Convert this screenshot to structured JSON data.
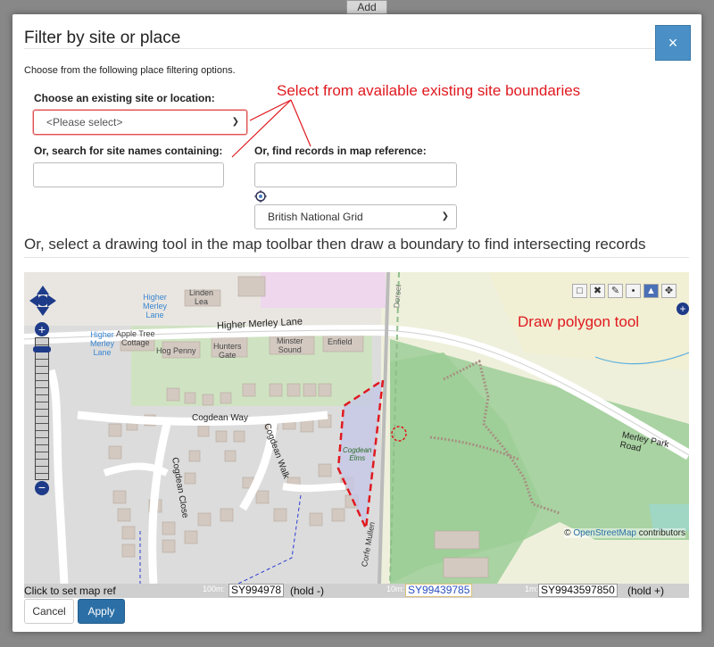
{
  "background": {
    "add_label": "Add"
  },
  "dialog": {
    "title": "Filter by site or place",
    "close_glyph": "×",
    "intro": "Choose from the following place filtering options.",
    "existing_site_label": "Choose an existing site or location:",
    "existing_site_value": "<Please select>",
    "search_label": "Or, search for site names containing:",
    "mapref_label": "Or, find records in map reference:",
    "grid_system_value": "British National Grid",
    "drawing_heading": "Or, select a drawing tool in the map toolbar then draw a boundary to find intersecting records",
    "annotation_select": "Select from available existing site boundaries",
    "annotation_draw": "Draw polygon tool"
  },
  "map": {
    "attribution_prefix": "© ",
    "attribution_link": "OpenStreetMap",
    "attribution_suffix": " contributors",
    "labels": {
      "higher_merley_lane": "Higher Merley Lane",
      "higher_merley_lane_1": "Higher",
      "higher_merley_lane_2": "Merley",
      "higher_merley_lane_3": "Lane",
      "merley_park_road": "Merley Park Road",
      "cogdean_way": "Cogdean Way",
      "cogdean_walk": "Cogdean Walk",
      "cogdean_close": "Cogdean Close",
      "cogdean_elms_1": "Cogdean",
      "cogdean_elms_2": "Elms",
      "corfe_mullen": "Corfe Mullen",
      "apple_tree_cottage_1": "Apple Tree",
      "apple_tree_cottage_2": "Cottage",
      "hog_penny": "Hog Penny",
      "hunters_gate_1": "Hunters",
      "hunters_gate_2": "Gate",
      "minster_sound_1": "Minster",
      "minster_sound_2": "Sound",
      "enfield": "Enfield",
      "linden_lea_1": "Linden",
      "linden_lea_2": "Lea",
      "dorset": "Dorset"
    },
    "toolbar_icons": [
      "select-box-icon",
      "clear-icon",
      "edit-icon",
      "draw-point-icon",
      "draw-polygon-icon",
      "pan-icon"
    ]
  },
  "status": {
    "click_text": "Click to set map ref",
    "scale_100m": "100m:",
    "ref_100m": "SY994978",
    "hold_minus": "(hold -)",
    "scale_10m": "10m:",
    "ref_10m": "SY99439785",
    "scale_1m": "1m:",
    "ref_1m": "SY9943597850",
    "hold_plus": "(hold +)"
  },
  "buttons": {
    "cancel": "Cancel",
    "apply": "Apply"
  },
  "colors": {
    "accent": "#2b6fa6",
    "annotation": "#e0191f",
    "close_bg": "#4a90c7"
  }
}
